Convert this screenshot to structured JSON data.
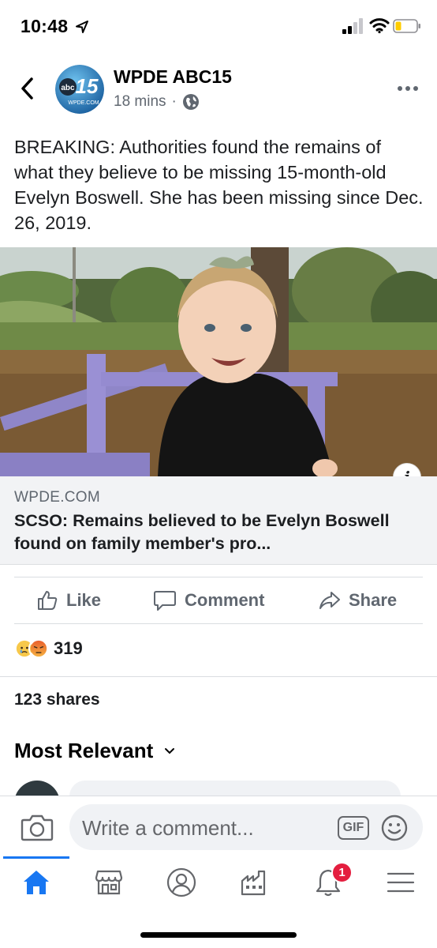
{
  "status_bar": {
    "time": "10:48",
    "icons": [
      "location-arrow-icon",
      "cellular-signal-icon",
      "wifi-icon",
      "battery-icon"
    ]
  },
  "header": {
    "page_name": "WPDE ABC15",
    "timestamp": "18 mins",
    "separator": "·",
    "privacy_icon": "globe-icon",
    "avatar_logo": {
      "badge": "abc",
      "number": "15",
      "caption": "WPDE.COM"
    }
  },
  "post": {
    "text": "BREAKING: Authorities found the remains of what they believe to be missing 15-month-old Evelyn Boswell. She has been missing since Dec. 26, 2019."
  },
  "link_preview": {
    "domain": "WPDE.COM",
    "title": "SCSO: Remains believed to be Evelyn Boswell found on family member's pro...",
    "info_icon": "i"
  },
  "actions": {
    "like": "Like",
    "comment": "Comment",
    "share": "Share"
  },
  "reactions": {
    "count": "319",
    "types": [
      "sad-reaction-icon",
      "angry-reaction-icon"
    ]
  },
  "shares_text": "123 shares",
  "comments": {
    "sort_label": "Most Relevant"
  },
  "composer": {
    "placeholder": "Write a comment...",
    "gif_label": "GIF"
  },
  "nav": {
    "items": [
      "home-icon",
      "marketplace-icon",
      "profile-icon",
      "pages-icon",
      "notifications-icon",
      "menu-icon"
    ],
    "notification_badge": "1",
    "active": "home"
  },
  "colors": {
    "accent": "#1877f2",
    "badge": "#e41e3f",
    "secondary_text": "#606770",
    "link_box_bg": "#f2f3f5"
  }
}
